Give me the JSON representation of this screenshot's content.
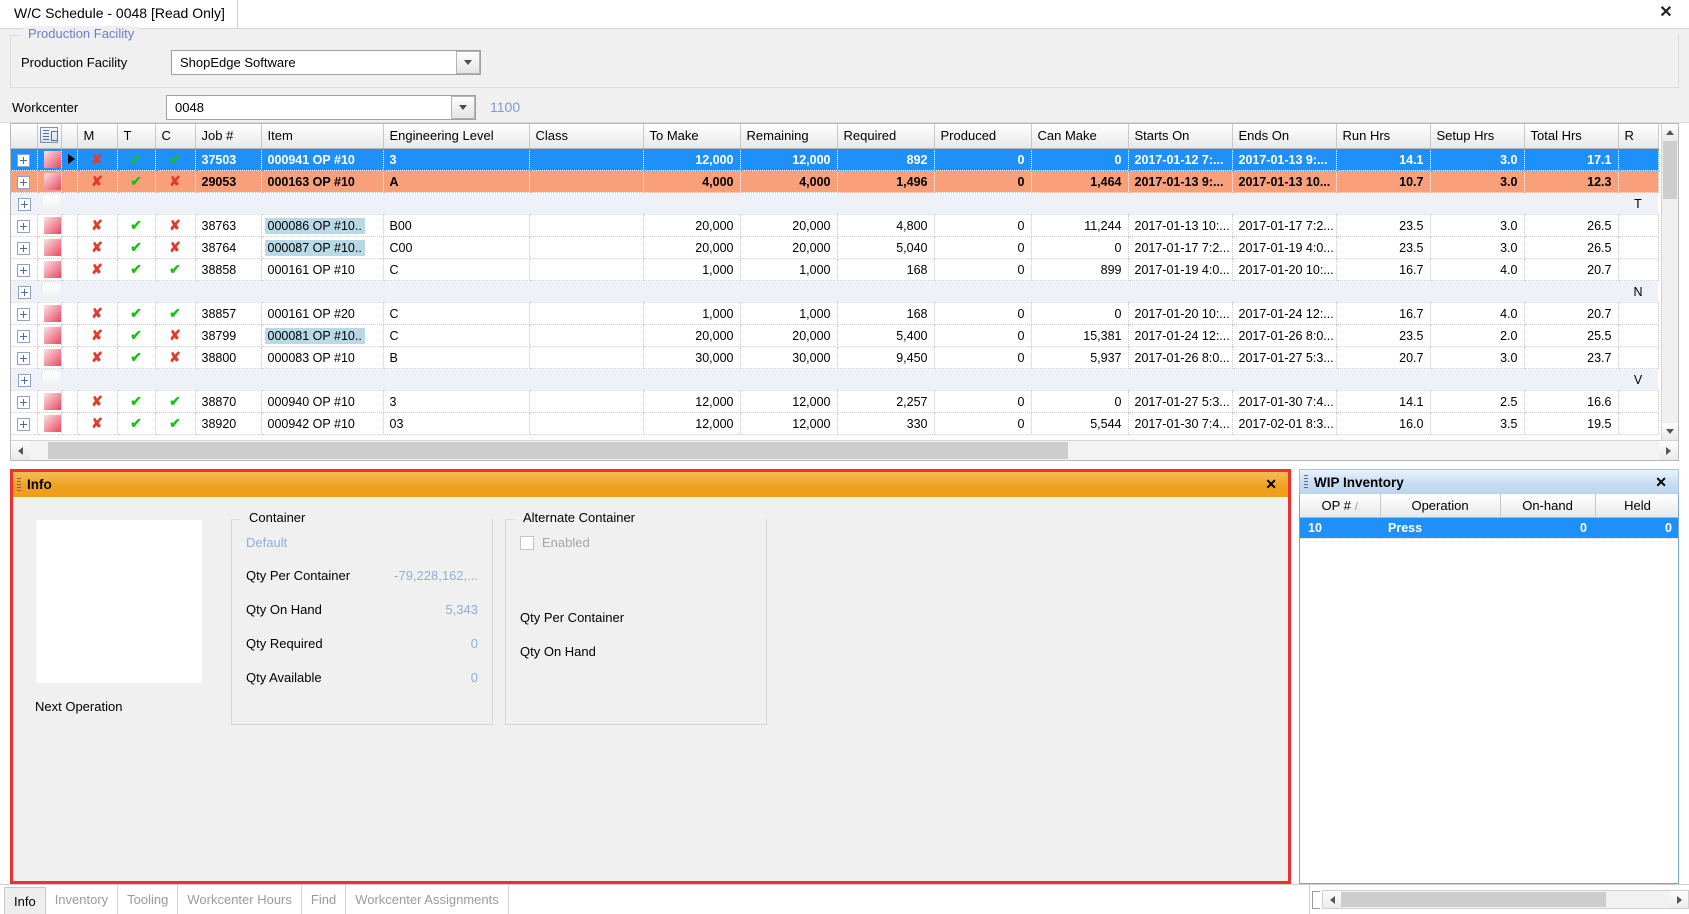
{
  "window": {
    "tab_title": "W/C Schedule - 0048 [Read Only]",
    "close_icon": "✕"
  },
  "production_facility_group": {
    "legend": "Production Facility",
    "field_label": "Production Facility",
    "value": "ShopEdge Software"
  },
  "workcenter": {
    "label": "Workcenter",
    "value": "0048",
    "suffix": "1100"
  },
  "grid": {
    "columns": [
      "M",
      "T",
      "C",
      "Job #",
      "Item",
      "Engineering Level",
      "Class",
      "To Make",
      "Remaining",
      "Required",
      "Produced",
      "Can Make",
      "Starts On",
      "Ends On",
      "Run Hrs",
      "Setup Hrs",
      "Total Hrs",
      "R"
    ],
    "rows": [
      {
        "type": "selected",
        "pointer": true,
        "mark": "red",
        "m": "✗",
        "t": "✓",
        "c": "✓",
        "job": "37503",
        "item": "000941 OP #10",
        "item_hl": false,
        "eng": "3",
        "class": "",
        "to_make": "12,000",
        "remaining": "12,000",
        "remaining_arrow": "",
        "required": "892",
        "produced": "0",
        "can_make": "0",
        "starts_on": "2017-01-12 7:...",
        "ends_on": "2017-01-13 9:...",
        "run_hrs": "14.1",
        "setup_hrs": "3.0",
        "total_hrs": "17.1",
        "r": ""
      },
      {
        "type": "orange",
        "pointer": false,
        "mark": "red",
        "m": "✗",
        "t": "✓",
        "c": "✗",
        "job": "29053",
        "item": "000163 OP #10",
        "item_hl": false,
        "eng": "A",
        "class": "",
        "to_make": "4,000",
        "remaining": "4,000",
        "remaining_arrow": "down",
        "required": "1,496",
        "produced": "0",
        "can_make": "1,464",
        "starts_on": "2017-01-13 9:...",
        "ends_on": "2017-01-13 10...",
        "run_hrs": "10.7",
        "setup_hrs": "3.0",
        "total_hrs": "12.3",
        "r": ""
      },
      {
        "type": "group",
        "r": "T"
      },
      {
        "type": "normal",
        "pointer": false,
        "mark": "red",
        "m": "✗",
        "t": "✓",
        "c": "✗",
        "job": "38763",
        "item": "000086 OP #10..",
        "item_hl": true,
        "eng": "B00",
        "class": "",
        "to_make": "20,000",
        "remaining": "20,000",
        "remaining_arrow": "",
        "required": "4,800",
        "produced": "0",
        "can_make": "11,244",
        "starts_on": "2017-01-13  10:...",
        "ends_on": "2017-01-17  7:2...",
        "run_hrs": "23.5",
        "setup_hrs": "3.0",
        "total_hrs": "26.5",
        "r": ""
      },
      {
        "type": "normal",
        "pointer": false,
        "mark": "red",
        "m": "✗",
        "t": "✓",
        "c": "✗",
        "job": "38764",
        "item": "000087 OP #10..",
        "item_hl": true,
        "eng": "C00",
        "class": "",
        "to_make": "20,000",
        "remaining": "20,000",
        "remaining_arrow": "",
        "required": "5,040",
        "produced": "0",
        "can_make": "0",
        "starts_on": "2017-01-17  7:2...",
        "ends_on": "2017-01-19  4:0...",
        "run_hrs": "23.5",
        "setup_hrs": "3.0",
        "total_hrs": "26.5",
        "r": ""
      },
      {
        "type": "normal",
        "pointer": false,
        "mark": "red",
        "m": "✗",
        "t": "✓",
        "c": "✓",
        "job": "38858",
        "item": "000161 OP #10",
        "item_hl": false,
        "eng": "C",
        "class": "",
        "to_make": "1,000",
        "remaining": "1,000",
        "remaining_arrow": "up",
        "required": "168",
        "produced": "0",
        "can_make": "899",
        "starts_on": "2017-01-19  4:0...",
        "ends_on": "2017-01-20  10:...",
        "run_hrs": "16.7",
        "setup_hrs": "4.0",
        "total_hrs": "20.7",
        "r": ""
      },
      {
        "type": "group",
        "r": "N"
      },
      {
        "type": "normal",
        "pointer": false,
        "mark": "red",
        "m": "✗",
        "t": "✓",
        "c": "✓",
        "job": "38857",
        "item": "000161 OP #20",
        "item_hl": false,
        "eng": "C",
        "class": "",
        "to_make": "1,000",
        "remaining": "1,000",
        "remaining_arrow": "up",
        "required": "168",
        "produced": "0",
        "can_make": "0",
        "starts_on": "2017-01-20  10:...",
        "ends_on": "2017-01-24  12:...",
        "run_hrs": "16.7",
        "setup_hrs": "4.0",
        "total_hrs": "20.7",
        "r": ""
      },
      {
        "type": "normal",
        "pointer": false,
        "mark": "red",
        "m": "✗",
        "t": "✓",
        "c": "✗",
        "job": "38799",
        "item": "000081 OP #10..",
        "item_hl": true,
        "eng": "C",
        "class": "",
        "to_make": "20,000",
        "remaining": "20,000",
        "remaining_arrow": "",
        "required": "5,400",
        "produced": "0",
        "can_make": "15,381",
        "starts_on": "2017-01-24  12:...",
        "ends_on": "2017-01-26  8:0...",
        "run_hrs": "23.5",
        "setup_hrs": "2.0",
        "total_hrs": "25.5",
        "r": ""
      },
      {
        "type": "normal",
        "pointer": false,
        "mark": "red",
        "m": "✗",
        "t": "✓",
        "c": "✗",
        "job": "38800",
        "item": "000083 OP #10",
        "item_hl": false,
        "eng": "B",
        "class": "",
        "to_make": "30,000",
        "remaining": "30,000",
        "remaining_arrow": "",
        "required": "9,450",
        "produced": "0",
        "can_make": "5,937",
        "starts_on": "2017-01-26  8:0...",
        "ends_on": "2017-01-27  5:3...",
        "run_hrs": "20.7",
        "setup_hrs": "3.0",
        "total_hrs": "23.7",
        "r": ""
      },
      {
        "type": "group",
        "r": "V"
      },
      {
        "type": "normal",
        "pointer": false,
        "mark": "red",
        "m": "✗",
        "t": "✓",
        "c": "✓",
        "job": "38870",
        "item": "000940 OP #10",
        "item_hl": false,
        "eng": "3",
        "class": "",
        "to_make": "12,000",
        "remaining": "12,000",
        "remaining_arrow": "",
        "required": "2,257",
        "produced": "0",
        "can_make": "0",
        "starts_on": "2017-01-27  5:3...",
        "ends_on": "2017-01-30  7:4...",
        "run_hrs": "14.1",
        "setup_hrs": "2.5",
        "total_hrs": "16.6",
        "r": ""
      },
      {
        "type": "normal",
        "pointer": false,
        "mark": "red",
        "m": "✗",
        "t": "✓",
        "c": "✓",
        "job": "38920",
        "item": "000942 OP #10",
        "item_hl": false,
        "eng": "03",
        "class": "",
        "to_make": "12,000",
        "remaining": "12,000",
        "remaining_arrow": "",
        "required": "330",
        "produced": "0",
        "can_make": "5,544",
        "starts_on": "2017-01-30  7:4...",
        "ends_on": "2017-02-01  8:3...",
        "run_hrs": "16.0",
        "setup_hrs": "3.5",
        "total_hrs": "19.5",
        "r": ""
      }
    ]
  },
  "info_panel": {
    "title": "Info",
    "close_icon": "✕",
    "next_operation_label": "Next Operation",
    "container": {
      "legend": "Container",
      "default_label": "Default",
      "rows": [
        {
          "label": "Qty Per Container",
          "value": "-79,228,162,..."
        },
        {
          "label": "Qty On Hand",
          "value": "5,343"
        },
        {
          "label": "Qty Required",
          "value": "0"
        },
        {
          "label": "Qty Available",
          "value": "0"
        }
      ]
    },
    "alternate_container": {
      "legend": "Alternate Container",
      "enabled_label": "Enabled",
      "enabled_checked": false,
      "rows": [
        {
          "label": "Qty Per Container",
          "value": ""
        },
        {
          "label": "Qty On Hand",
          "value": ""
        }
      ]
    }
  },
  "wip_panel": {
    "title": "WIP Inventory",
    "close_icon": "✕",
    "columns": [
      "OP #",
      "Operation",
      "On-hand",
      "Held"
    ],
    "sort_indicator": "/",
    "rows": [
      {
        "op": "10",
        "operation": "Press",
        "on_hand": "0",
        "held": "0"
      }
    ]
  },
  "tabbar": {
    "tabs": [
      {
        "label": "Info",
        "active": true
      },
      {
        "label": "Inventory",
        "active": false
      },
      {
        "label": "Tooling",
        "active": false
      },
      {
        "label": "Workcenter Hours",
        "active": false
      },
      {
        "label": "Find",
        "active": false
      },
      {
        "label": "Workcenter Assignments",
        "active": false
      }
    ]
  }
}
